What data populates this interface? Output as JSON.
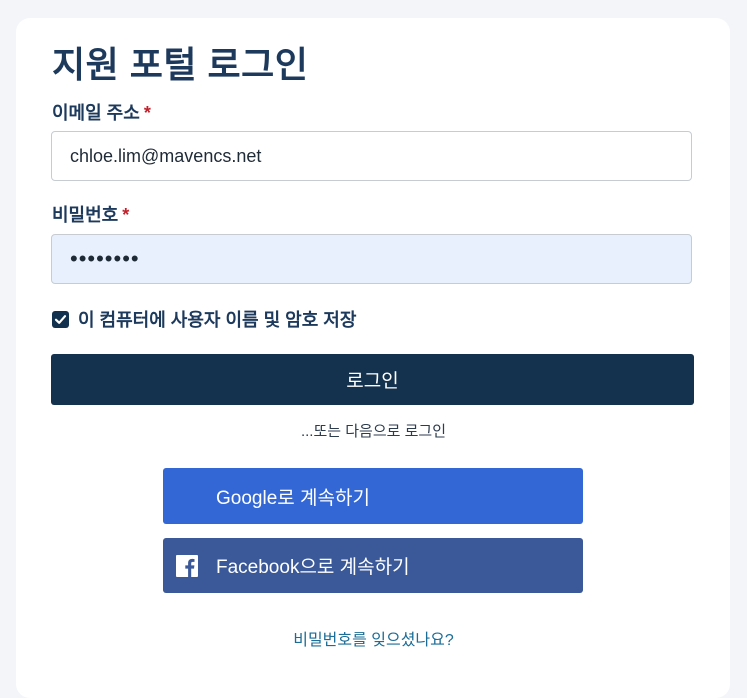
{
  "form": {
    "title": "지원 포털 로그인",
    "email": {
      "label": "이메일 주소",
      "required_marker": "*",
      "value": "chloe.lim@mavencs.net"
    },
    "password": {
      "label": "비밀번호",
      "required_marker": "*",
      "masked_value": "••••••••"
    },
    "remember": {
      "label": "이 컴퓨터에 사용자 이름 및 암호 저장",
      "checked": true
    },
    "login_button": "로그인",
    "divider_text": "...또는 다음으로 로그인",
    "social": {
      "google_label": "Google로 계속하기",
      "facebook_label": "Facebook으로 계속하기"
    },
    "forgot_link": "비밀번호를 잊으셨나요?"
  },
  "colors": {
    "title": "#1d3a5c",
    "required": "#c0202a",
    "primary_button": "#14314d",
    "google": "#3367d6",
    "facebook": "#3b5998",
    "link": "#1b6c96",
    "autofill_bg": "#e8f0fe"
  },
  "icons": {
    "checkbox": "check-icon",
    "facebook": "facebook-icon"
  }
}
